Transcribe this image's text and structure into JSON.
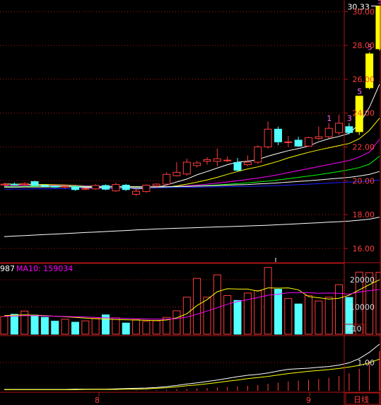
{
  "colors": {
    "background": "#000000",
    "frame": "#b01414",
    "grid": "#b01414",
    "up": "#ff3c3c",
    "down": "#54ffff",
    "limit_up": "#ffff00",
    "axis_text": "#ff3c3c",
    "ma5": "#ffffff",
    "ma10": "#ffff00",
    "ma20": "#ff00ff",
    "ma30": "#00ff00",
    "ma60": "#ffffff",
    "ma120": "#2020ff",
    "ma250": "#ffffff",
    "vol_ma5": "#ffff00",
    "vol_ma10": "#ff00ff",
    "ind_line1": "#ffffff",
    "ind_line2": "#ffff00"
  },
  "header": {
    "volume_legend_partial": "987",
    "volume_ma10_label": "MA10: 159034"
  },
  "footer": {
    "period_button": "日线",
    "date_ticks": [
      "8",
      "9"
    ]
  },
  "chart_data": [
    {
      "type": "candlestick",
      "panel": "price",
      "ylim": [
        15.2,
        30.6
      ],
      "y_ticks": [
        "16.00",
        "18.00",
        "20.00",
        "22.00",
        "24.00",
        "26.00",
        "28.00",
        "30.00"
      ],
      "max_label": "30.33",
      "candles": [
        {
          "o": 19.75,
          "h": 19.88,
          "l": 19.7,
          "c": 19.8
        },
        {
          "o": 19.8,
          "h": 19.9,
          "l": 19.72,
          "c": 19.78
        },
        {
          "o": 19.78,
          "h": 19.92,
          "l": 19.7,
          "c": 19.84
        },
        {
          "o": 19.95,
          "h": 20.0,
          "l": 19.7,
          "c": 19.72
        },
        {
          "o": 19.72,
          "h": 19.8,
          "l": 19.62,
          "c": 19.66
        },
        {
          "o": 19.68,
          "h": 19.72,
          "l": 19.58,
          "c": 19.62
        },
        {
          "o": 19.62,
          "h": 19.72,
          "l": 19.55,
          "c": 19.66
        },
        {
          "o": 19.64,
          "h": 19.72,
          "l": 19.4,
          "c": 19.48
        },
        {
          "o": 19.5,
          "h": 19.58,
          "l": 19.44,
          "c": 19.54
        },
        {
          "o": 19.52,
          "h": 19.8,
          "l": 19.46,
          "c": 19.72
        },
        {
          "o": 19.72,
          "h": 19.78,
          "l": 19.44,
          "c": 19.5
        },
        {
          "o": 19.4,
          "h": 19.88,
          "l": 19.35,
          "c": 19.78
        },
        {
          "o": 19.74,
          "h": 19.82,
          "l": 19.4,
          "c": 19.48
        },
        {
          "o": 19.2,
          "h": 19.52,
          "l": 19.1,
          "c": 19.38
        },
        {
          "o": 19.36,
          "h": 19.78,
          "l": 19.3,
          "c": 19.74
        },
        {
          "o": 19.7,
          "h": 19.85,
          "l": 19.62,
          "c": 19.8
        },
        {
          "o": 19.8,
          "h": 20.5,
          "l": 19.74,
          "c": 20.38
        },
        {
          "o": 20.3,
          "h": 21.1,
          "l": 20.25,
          "c": 20.5
        },
        {
          "o": 20.4,
          "h": 21.3,
          "l": 20.3,
          "c": 21.1
        },
        {
          "o": 20.9,
          "h": 21.18,
          "l": 20.78,
          "c": 21.05
        },
        {
          "o": 21.15,
          "h": 21.4,
          "l": 20.95,
          "c": 21.25
        },
        {
          "o": 21.15,
          "h": 21.9,
          "l": 20.85,
          "c": 21.3
        },
        {
          "o": 21.2,
          "h": 21.45,
          "l": 21.1,
          "c": 21.22
        },
        {
          "o": 21.08,
          "h": 21.35,
          "l": 20.55,
          "c": 20.62
        },
        {
          "o": 20.95,
          "h": 21.5,
          "l": 20.85,
          "c": 21.1
        },
        {
          "o": 21.1,
          "h": 22.1,
          "l": 21.0,
          "c": 22.0
        },
        {
          "o": 22.0,
          "h": 23.5,
          "l": 21.9,
          "c": 23.05
        },
        {
          "o": 23.05,
          "h": 23.2,
          "l": 22.1,
          "c": 22.3
        },
        {
          "o": 22.3,
          "h": 22.65,
          "l": 22.0,
          "c": 22.3
        },
        {
          "o": 22.4,
          "h": 22.6,
          "l": 22.0,
          "c": 22.05
        },
        {
          "o": 22.05,
          "h": 22.6,
          "l": 22.0,
          "c": 22.55
        },
        {
          "o": 22.5,
          "h": 23.2,
          "l": 22.4,
          "c": 22.6
        },
        {
          "o": 22.6,
          "h": 23.4,
          "l": 22.5,
          "c": 23.1
        },
        {
          "o": 22.85,
          "h": 23.9,
          "l": 22.7,
          "c": 23.4
        },
        {
          "o": 23.2,
          "h": 23.4,
          "l": 22.75,
          "c": 22.85
        },
        {
          "o": 22.9,
          "h": 25.0,
          "l": 22.7,
          "c": 25.0
        },
        {
          "o": 25.5,
          "h": 27.6,
          "l": 25.4,
          "c": 27.5
        },
        {
          "o": 27.8,
          "h": 30.33,
          "l": 27.7,
          "c": 30.33
        }
      ],
      "markers": [
        {
          "index": 32,
          "text": "1"
        },
        {
          "index": 34,
          "text": "3"
        },
        {
          "index": 35,
          "text": "5"
        },
        {
          "index": 36,
          "text": "5"
        },
        {
          "index": 37,
          "text": "5"
        }
      ],
      "ma_lines": [
        {
          "name": "MA5",
          "color_key": "ma5",
          "values": [
            19.82,
            19.8,
            19.8,
            19.78,
            19.75,
            19.72,
            19.7,
            19.65,
            19.6,
            19.6,
            19.58,
            19.56,
            19.58,
            19.52,
            19.55,
            19.6,
            19.75,
            19.93,
            20.1,
            20.35,
            20.55,
            20.75,
            20.95,
            21.1,
            21.15,
            21.25,
            21.45,
            21.62,
            21.78,
            21.9,
            22.05,
            22.3,
            22.48,
            22.62,
            22.8,
            23.35,
            24.35,
            25.7
          ]
        },
        {
          "name": "MA10",
          "color_key": "ma10",
          "values": [
            19.8,
            19.8,
            19.79,
            19.78,
            19.78,
            19.76,
            19.75,
            19.73,
            19.7,
            19.68,
            19.66,
            19.64,
            19.62,
            19.6,
            19.58,
            19.58,
            19.62,
            19.7,
            19.8,
            19.92,
            20.05,
            20.2,
            20.38,
            20.55,
            20.7,
            20.82,
            20.98,
            21.15,
            21.35,
            21.52,
            21.68,
            21.82,
            21.95,
            22.08,
            22.2,
            22.48,
            22.98,
            23.7
          ]
        },
        {
          "name": "MA20",
          "color_key": "ma20",
          "values": [
            19.7,
            19.71,
            19.72,
            19.72,
            19.72,
            19.72,
            19.72,
            19.71,
            19.7,
            19.69,
            19.68,
            19.67,
            19.66,
            19.65,
            19.64,
            19.63,
            19.64,
            19.66,
            19.7,
            19.74,
            19.8,
            19.86,
            19.93,
            20.0,
            20.08,
            20.16,
            20.25,
            20.36,
            20.48,
            20.6,
            20.72,
            20.84,
            20.96,
            21.08,
            21.2,
            21.4,
            21.7,
            22.45
          ]
        },
        {
          "name": "MA30",
          "color_key": "ma30",
          "values": [
            19.66,
            19.67,
            19.67,
            19.68,
            19.68,
            19.68,
            19.68,
            19.68,
            19.67,
            19.67,
            19.66,
            19.66,
            19.65,
            19.65,
            19.64,
            19.64,
            19.64,
            19.65,
            19.67,
            19.69,
            19.72,
            19.75,
            19.79,
            19.83,
            19.88,
            19.93,
            19.98,
            20.05,
            20.12,
            20.2,
            20.28,
            20.36,
            20.45,
            20.55,
            20.65,
            20.78,
            20.98,
            21.45
          ]
        },
        {
          "name": "MA60",
          "color_key": "ma60",
          "values": [
            19.62,
            19.62,
            19.63,
            19.63,
            19.63,
            19.64,
            19.64,
            19.64,
            19.64,
            19.64,
            19.64,
            19.64,
            19.64,
            19.64,
            19.64,
            19.64,
            19.65,
            19.66,
            19.67,
            19.68,
            19.7,
            19.72,
            19.74,
            19.76,
            19.78,
            19.81,
            19.84,
            19.88,
            19.92,
            19.96,
            20.0,
            20.05,
            20.1,
            20.15,
            20.2,
            20.28,
            20.38,
            20.55
          ]
        },
        {
          "name": "MA120",
          "color_key": "ma120",
          "values": [
            19.5,
            19.51,
            19.51,
            19.52,
            19.52,
            19.53,
            19.53,
            19.54,
            19.54,
            19.55,
            19.55,
            19.56,
            19.56,
            19.57,
            19.57,
            19.58,
            19.59,
            19.6,
            19.61,
            19.62,
            19.63,
            19.64,
            19.65,
            19.66,
            19.67,
            19.68,
            19.7,
            19.72,
            19.74,
            19.77,
            19.8,
            19.83,
            19.86,
            19.89,
            19.92,
            19.95,
            19.99,
            20.05
          ]
        },
        {
          "name": "MA250",
          "color_key": "ma250",
          "values": [
            16.7,
            16.73,
            16.76,
            16.79,
            16.82,
            16.85,
            16.88,
            16.91,
            16.94,
            16.97,
            17.0,
            17.03,
            17.06,
            17.09,
            17.12,
            17.15,
            17.17,
            17.19,
            17.21,
            17.23,
            17.25,
            17.27,
            17.29,
            17.31,
            17.33,
            17.35,
            17.37,
            17.4,
            17.43,
            17.46,
            17.49,
            17.52,
            17.55,
            17.58,
            17.62,
            17.67,
            17.73,
            17.85
          ]
        }
      ]
    },
    {
      "type": "bar",
      "panel": "volume",
      "ylim": [
        0,
        26000
      ],
      "y_ticks": [
        "10000",
        "20000"
      ],
      "unit_label": "X10",
      "values": [
        6500,
        7300,
        8500,
        7000,
        6200,
        4800,
        5500,
        4400,
        4900,
        5800,
        7100,
        6000,
        4100,
        5300,
        4700,
        4900,
        6200,
        8600,
        13600,
        20500,
        13600,
        21800,
        14200,
        12400,
        15100,
        16000,
        24500,
        16500,
        13100,
        11100,
        14200,
        12200,
        13600,
        18200,
        13500,
        22800,
        22600,
        22700
      ],
      "ma5": [
        6800,
        7000,
        7100,
        7000,
        6800,
        6600,
        6400,
        6200,
        5900,
        5700,
        5600,
        5400,
        5300,
        5200,
        5100,
        5000,
        5200,
        6000,
        7500,
        10500,
        12700,
        15600,
        16700,
        16600,
        16600,
        15800,
        17000,
        16900,
        17000,
        16300,
        13800,
        13400,
        12900,
        13200,
        14300,
        16300,
        18200,
        20000
      ],
      "ma10": [
        6600,
        6700,
        6800,
        6800,
        6700,
        6600,
        6500,
        6400,
        6300,
        6200,
        6000,
        5900,
        5800,
        5700,
        5600,
        5500,
        5500,
        5700,
        6300,
        7300,
        8500,
        9700,
        11000,
        12000,
        12700,
        13500,
        14300,
        14700,
        15200,
        15300,
        15300,
        15000,
        15100,
        15000,
        14700,
        15500,
        16000,
        16400
      ]
    },
    {
      "type": "line",
      "panel": "indicator",
      "ylim": [
        0,
        1.9
      ],
      "y_ticks": [
        "1.00"
      ],
      "series": [
        {
          "color_key": "ind_line1",
          "values": [
            0.05,
            0.05,
            0.05,
            0.05,
            0.05,
            0.05,
            0.05,
            0.06,
            0.06,
            0.06,
            0.06,
            0.07,
            0.08,
            0.09,
            0.1,
            0.12,
            0.15,
            0.19,
            0.24,
            0.28,
            0.33,
            0.38,
            0.44,
            0.5,
            0.55,
            0.58,
            0.63,
            0.7,
            0.76,
            0.78,
            0.8,
            0.83,
            0.86,
            0.91,
            0.99,
            1.14,
            1.36,
            1.65
          ]
        },
        {
          "color_key": "ind_line2",
          "values": [
            0.04,
            0.04,
            0.04,
            0.04,
            0.04,
            0.04,
            0.04,
            0.04,
            0.05,
            0.05,
            0.05,
            0.05,
            0.06,
            0.06,
            0.07,
            0.09,
            0.11,
            0.14,
            0.18,
            0.21,
            0.25,
            0.29,
            0.34,
            0.38,
            0.43,
            0.47,
            0.51,
            0.56,
            0.61,
            0.65,
            0.69,
            0.72,
            0.75,
            0.79,
            0.84,
            0.9,
            0.99,
            1.12
          ]
        }
      ],
      "bars": [
        0.0,
        0.0,
        0.0,
        0.0,
        0.0,
        0.0,
        0.0,
        0.0,
        0.0,
        0.0,
        0.0,
        0.01,
        0.01,
        0.02,
        0.02,
        0.03,
        0.04,
        0.06,
        0.07,
        0.09,
        0.1,
        0.12,
        0.14,
        0.16,
        0.18,
        0.21,
        0.25,
        0.29,
        0.33,
        0.36,
        0.39,
        0.42,
        0.46,
        0.52,
        0.62,
        0.78,
        1.05,
        1.4
      ]
    }
  ]
}
